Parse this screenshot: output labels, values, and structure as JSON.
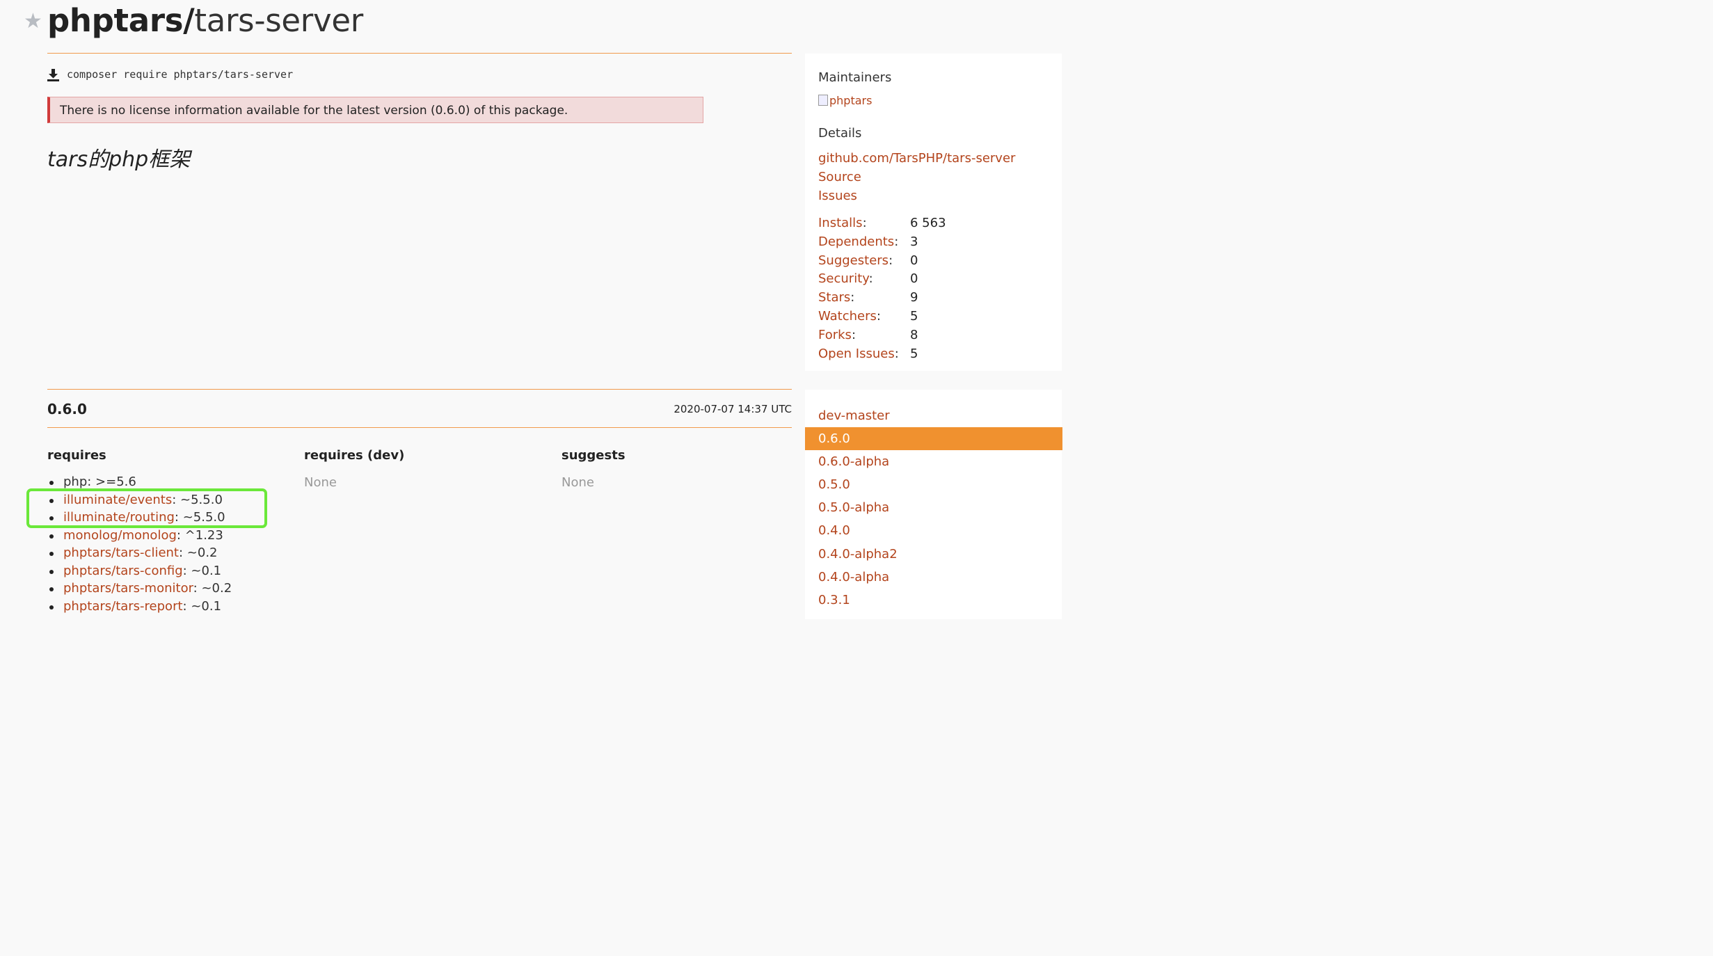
{
  "header": {
    "star_icon": "star-icon",
    "vendor": "phptars/",
    "package": "tars-server"
  },
  "install": {
    "icon": "download-icon",
    "command": "composer require phptars/tars-server"
  },
  "alert": {
    "text": "There is no license information available for the latest version (0.6.0) of this package.",
    "accent_color": "#d13b3b",
    "background": "#f2dbdb"
  },
  "description": "tars的php框架",
  "version": {
    "name": "0.6.0",
    "date": "2020-07-07 14:37 UTC",
    "columns": {
      "requires": "requires",
      "requires_dev": "requires (dev)",
      "suggests": "suggests"
    },
    "requires_dev_value": "None",
    "suggests_value": "None",
    "requires": [
      {
        "name": "php",
        "constraint": ": >=5.6",
        "is_link": false
      },
      {
        "name": "illuminate/events",
        "constraint": ": ~5.5.0",
        "is_link": true
      },
      {
        "name": "illuminate/routing",
        "constraint": ": ~5.5.0",
        "is_link": true
      },
      {
        "name": "monolog/monolog",
        "constraint": ": ^1.23",
        "is_link": true
      },
      {
        "name": "phptars/tars-client",
        "constraint": ": ~0.2",
        "is_link": true
      },
      {
        "name": "phptars/tars-config",
        "constraint": ": ~0.1",
        "is_link": true
      },
      {
        "name": "phptars/tars-monitor",
        "constraint": ": ~0.2",
        "is_link": true
      },
      {
        "name": "phptars/tars-report",
        "constraint": ": ~0.1",
        "is_link": true
      }
    ],
    "highlight_color": "#6be83a"
  },
  "sidebar": {
    "maintainers_label": "Maintainers",
    "maintainer_image_alt": "phptars",
    "details_label": "Details",
    "links": {
      "repo": "github.com/TarsPHP/tars-server",
      "source": "Source",
      "issues": "Issues"
    },
    "stats": [
      {
        "label": "Installs",
        "value": "6 563"
      },
      {
        "label": "Dependents",
        "value": "3"
      },
      {
        "label": "Suggesters",
        "value": "0"
      },
      {
        "label": "Security",
        "value": "0"
      },
      {
        "label": "Stars",
        "value": "9"
      },
      {
        "label": "Watchers",
        "value": "5"
      },
      {
        "label": "Forks",
        "value": "8"
      },
      {
        "label": "Open Issues",
        "value": "5"
      }
    ],
    "versions": [
      {
        "label": "dev-master",
        "active": false
      },
      {
        "label": "0.6.0",
        "active": true
      },
      {
        "label": "0.6.0-alpha",
        "active": false
      },
      {
        "label": "0.5.0",
        "active": false
      },
      {
        "label": "0.5.0-alpha",
        "active": false
      },
      {
        "label": "0.4.0",
        "active": false
      },
      {
        "label": "0.4.0-alpha2",
        "active": false
      },
      {
        "label": "0.4.0-alpha",
        "active": false
      },
      {
        "label": "0.3.1",
        "active": false
      }
    ]
  },
  "colors": {
    "link": "#b3441c",
    "accent": "#f0912f",
    "rule": "#f19a4c"
  }
}
